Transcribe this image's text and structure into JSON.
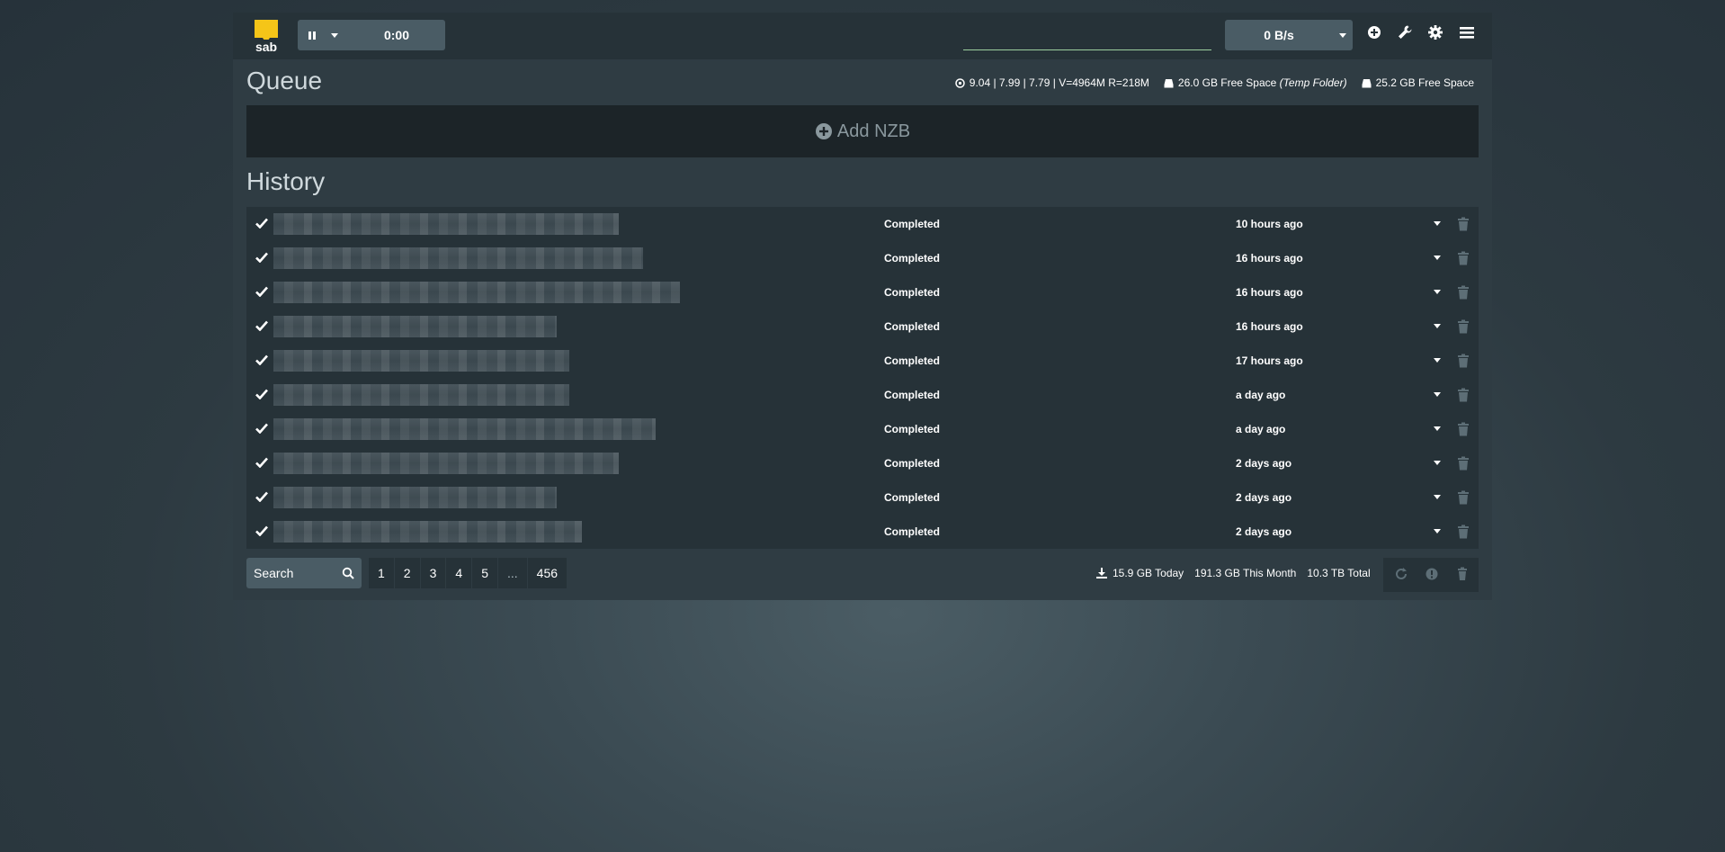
{
  "colors": {
    "page_bg": "#2d3a41",
    "panel_bg": "#263238",
    "accent_logo": "#f5c518",
    "speed_underline": "#9ccf9e",
    "muted_text": "#8a989e"
  },
  "logo": {
    "text": "sab"
  },
  "toolbar": {
    "pause_icon": "pause-icon",
    "pause_time": "0:00",
    "speed_value": "0 B/s",
    "icons": [
      "add-circle-icon",
      "wrench-icon",
      "gear-icon",
      "hamburger-menu-icon"
    ]
  },
  "queue": {
    "title": "Queue",
    "sysload": "9.04 | 7.99 | 7.79 | V=4964M R=218M",
    "temp_free": "26.0 GB Free Space",
    "temp_label": "(Temp Folder)",
    "complete_free": "25.2 GB Free Space",
    "add_nzb": "Add NZB"
  },
  "history": {
    "title": "History",
    "rows": [
      {
        "status": "Completed",
        "time": "10 hours ago",
        "name_blur": 0.28
      },
      {
        "status": "Completed",
        "time": "16 hours ago",
        "name_blur": 0.3
      },
      {
        "status": "Completed",
        "time": "16 hours ago",
        "name_blur": 0.33
      },
      {
        "status": "Completed",
        "time": "16 hours ago",
        "name_blur": 0.23
      },
      {
        "status": "Completed",
        "time": "17 hours ago",
        "name_blur": 0.24
      },
      {
        "status": "Completed",
        "time": "a day ago",
        "name_blur": 0.24
      },
      {
        "status": "Completed",
        "time": "a day ago",
        "name_blur": 0.31
      },
      {
        "status": "Completed",
        "time": "2 days ago",
        "name_blur": 0.28
      },
      {
        "status": "Completed",
        "time": "2 days ago",
        "name_blur": 0.23
      },
      {
        "status": "Completed",
        "time": "2 days ago",
        "name_blur": 0.25
      }
    ]
  },
  "footer": {
    "search_placeholder": "Search",
    "pages": [
      "1",
      "2",
      "3",
      "4",
      "5",
      "...",
      "456"
    ],
    "today": "15.9 GB Today",
    "month": "191.3 GB This Month",
    "total": "10.3 TB Total"
  }
}
